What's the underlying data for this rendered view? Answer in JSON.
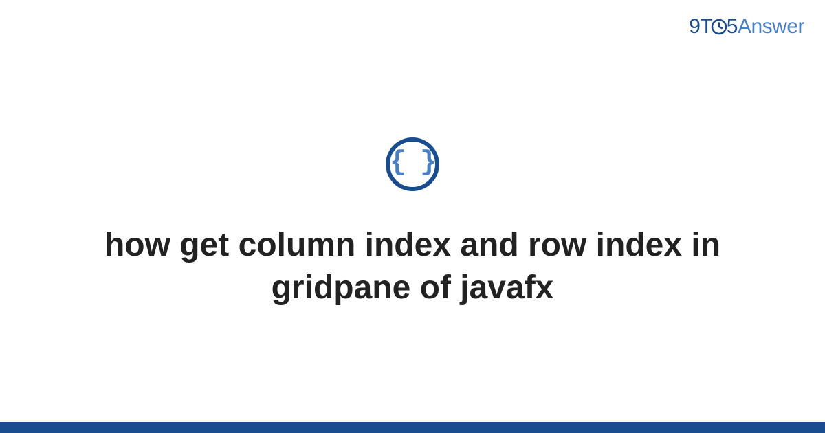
{
  "brand": {
    "part1": "9",
    "part2": "T",
    "part3": "5",
    "part4": "Answer"
  },
  "icon": {
    "glyph": "{ }"
  },
  "title": "how get column index and row index in gridpane of javafx",
  "colors": {
    "accent_dark": "#1a4d8f",
    "accent_light": "#4a7fc4",
    "text": "#222222"
  }
}
